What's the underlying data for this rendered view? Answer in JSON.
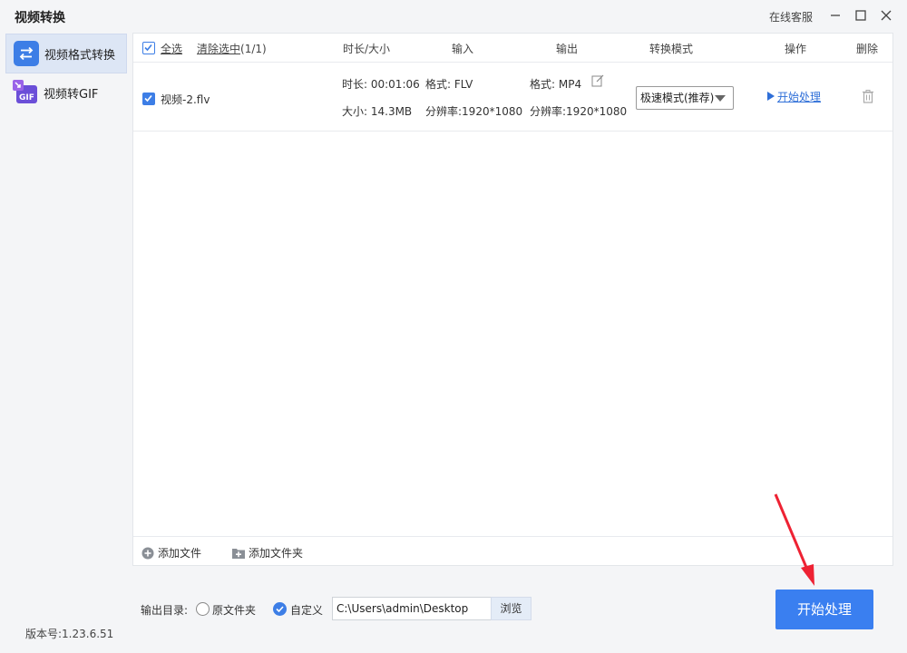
{
  "window": {
    "title": "视频转换",
    "support_label": "在线客服"
  },
  "sidebar": {
    "items": [
      {
        "label": "视频格式转换",
        "icon": "swap-arrows-icon",
        "active": true
      },
      {
        "label": "视频转GIF",
        "icon": "gif-icon",
        "active": false
      }
    ],
    "version": "版本号:1.23.6.51"
  },
  "table": {
    "select_all_label": "全选",
    "clear_selection_label": "清除选中",
    "selection_count": "(1/1)",
    "columns": {
      "duration_size": "时长/大小",
      "input": "输入",
      "output": "输出",
      "mode": "转换模式",
      "action": "操作",
      "delete": "删除"
    },
    "rows": [
      {
        "checked": true,
        "filename": "视频-2.flv",
        "duration": "时长: 00:01:06",
        "size": "大小: 14.3MB",
        "input_format": "格式: FLV",
        "input_resolution": "分辨率:1920*1080",
        "output_format": "格式: MP4",
        "output_resolution": "分辨率:1920*1080",
        "mode": "极速模式(推荐)",
        "action_label": "开始处理"
      }
    ]
  },
  "footer": {
    "add_file_label": "添加文件",
    "add_folder_label": "添加文件夹"
  },
  "output": {
    "label": "输出目录:",
    "option_original": "原文件夹",
    "option_custom": "自定义",
    "selected": "custom",
    "path": "C:\\Users\\admin\\Desktop",
    "browse_label": "浏览"
  },
  "start_button_label": "开始处理",
  "colors": {
    "accent": "#3a7ff0",
    "sidebar_active": "#dde6f5",
    "annotation_arrow": "#ee2233"
  }
}
